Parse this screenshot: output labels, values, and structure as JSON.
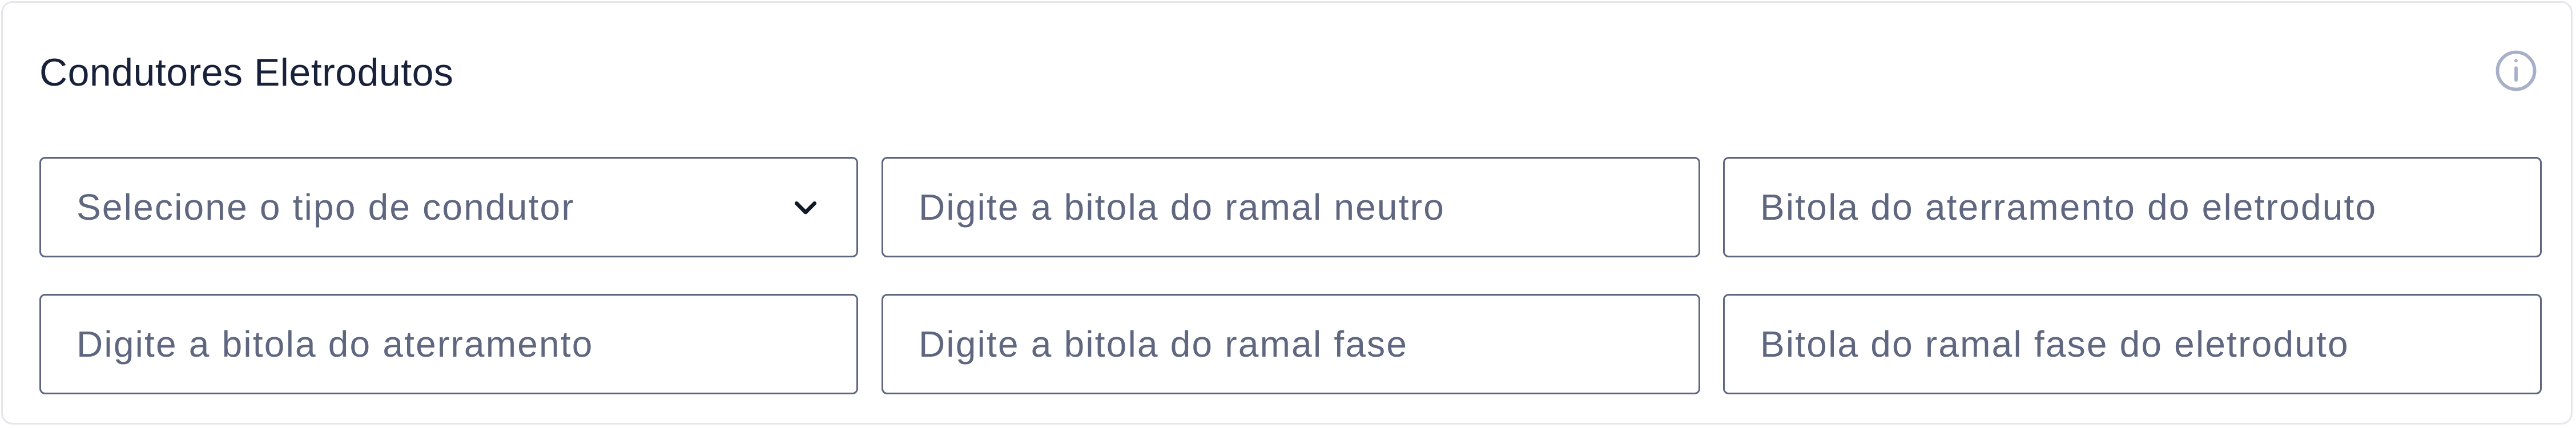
{
  "section": {
    "title": "Condutores Eletrodutos"
  },
  "icons": {
    "info": "info-circle-icon",
    "dropdown": "chevron-down-icon"
  },
  "fields": {
    "conductor_type": {
      "selected_value": "Selecione o tipo de condutor"
    },
    "neutral_branch_gauge": {
      "placeholder": "Digite a bitola do ramal neutro",
      "value": ""
    },
    "conduit_grounding_gauge": {
      "placeholder": "Bitola do aterramento do eletroduto",
      "value": ""
    },
    "grounding_gauge": {
      "placeholder": "Digite a bitola do aterramento",
      "value": ""
    },
    "phase_branch_gauge": {
      "placeholder": "Digite a bitola do ramal fase",
      "value": ""
    },
    "conduit_phase_branch_gauge": {
      "placeholder": "Bitola do ramal fase do eletroduto",
      "value": ""
    }
  },
  "colors": {
    "title": "#17213a",
    "field_border": "#5f6680",
    "placeholder": "#5e6680",
    "card_border": "#e3e6ef",
    "info_icon": "#a7b0c8"
  }
}
